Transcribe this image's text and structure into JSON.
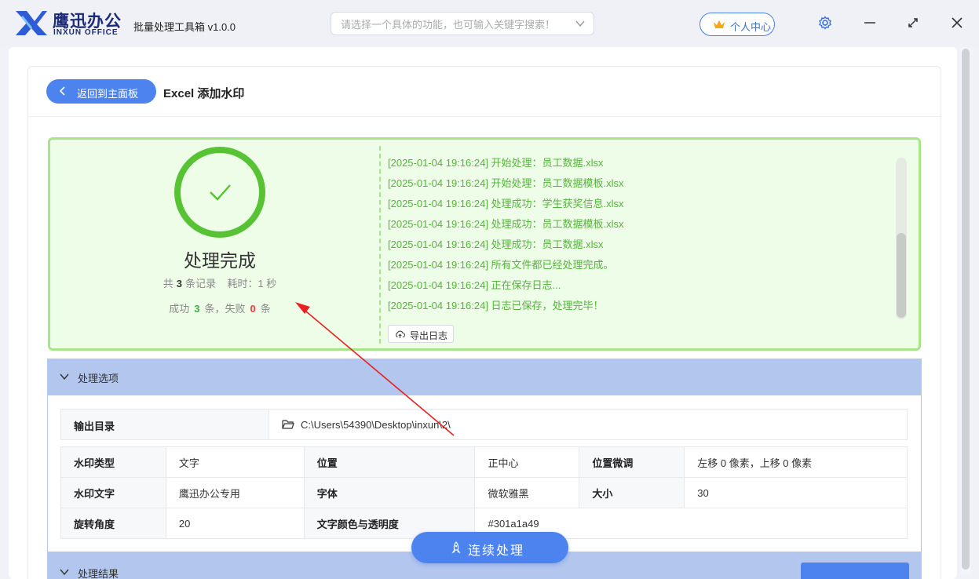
{
  "app": {
    "logo_cn": "鹰迅办公",
    "logo_en": "INXUN OFFICE",
    "title": "批量处理工具箱 v1.0.0"
  },
  "search": {
    "placeholder": "请选择一个具体的功能，也可输入关键字搜索！"
  },
  "user_center": "个人中心",
  "header": {
    "back_label": "返回到主面板",
    "page_title": "Excel 添加水印"
  },
  "result": {
    "status_title": "处理完成",
    "total_prefix": "共",
    "total": "3",
    "total_suffix": "条记录",
    "elapsed_label": "耗时：1 秒",
    "success_prefix": "成功",
    "success": "3",
    "success_suffix": "条，失败",
    "fail": "0",
    "fail_suffix": "条",
    "export_label": "导出日志"
  },
  "log": [
    "[2025-01-04 19:16:24] 开始处理：员工数据.xlsx",
    "[2025-01-04 19:16:24] 开始处理：员工数据模板.xlsx",
    "[2025-01-04 19:16:24] 处理成功：学生获奖信息.xlsx",
    "[2025-01-04 19:16:24] 处理成功：员工数据模板.xlsx",
    "[2025-01-04 19:16:24] 处理成功：员工数据.xlsx",
    "[2025-01-04 19:16:24] 所有文件都已经处理完成。",
    "[2025-01-04 19:16:24] 正在保存日志...",
    "[2025-01-04 19:16:24] 日志已保存，处理完毕！"
  ],
  "options": {
    "section_title": "处理选项",
    "output_dir_label": "输出目录",
    "output_dir": "C:\\Users\\54390\\Desktop\\inxun\\2\\",
    "rows": [
      [
        "水印类型",
        "文字",
        "位置",
        "正中心",
        "位置微调",
        "左移 0 像素，上移 0 像素"
      ],
      [
        "水印文字",
        "鹰迅办公专用",
        "字体",
        "微软雅黑",
        "大小",
        "30"
      ],
      [
        "旋转角度",
        "20",
        "文字颜色与透明度",
        "#301a1a49",
        "",
        ""
      ]
    ]
  },
  "continue_label": "连续处理",
  "result_section_title": "处理结果",
  "colors": {
    "accent": "#4c83ee",
    "success_green": "#56b33c",
    "panel_bg": "#eefde8",
    "section_header": "#b3c6ee",
    "fail_red": "#ee3b3b"
  },
  "icons": [
    "logo-icon",
    "chevron-down-icon",
    "crown-icon",
    "settings-icon",
    "minimize-icon",
    "maximize-icon",
    "close-icon",
    "back-arrow-icon",
    "check-circle-icon",
    "cloud-upload-icon",
    "folder-icon",
    "rocket-icon"
  ]
}
